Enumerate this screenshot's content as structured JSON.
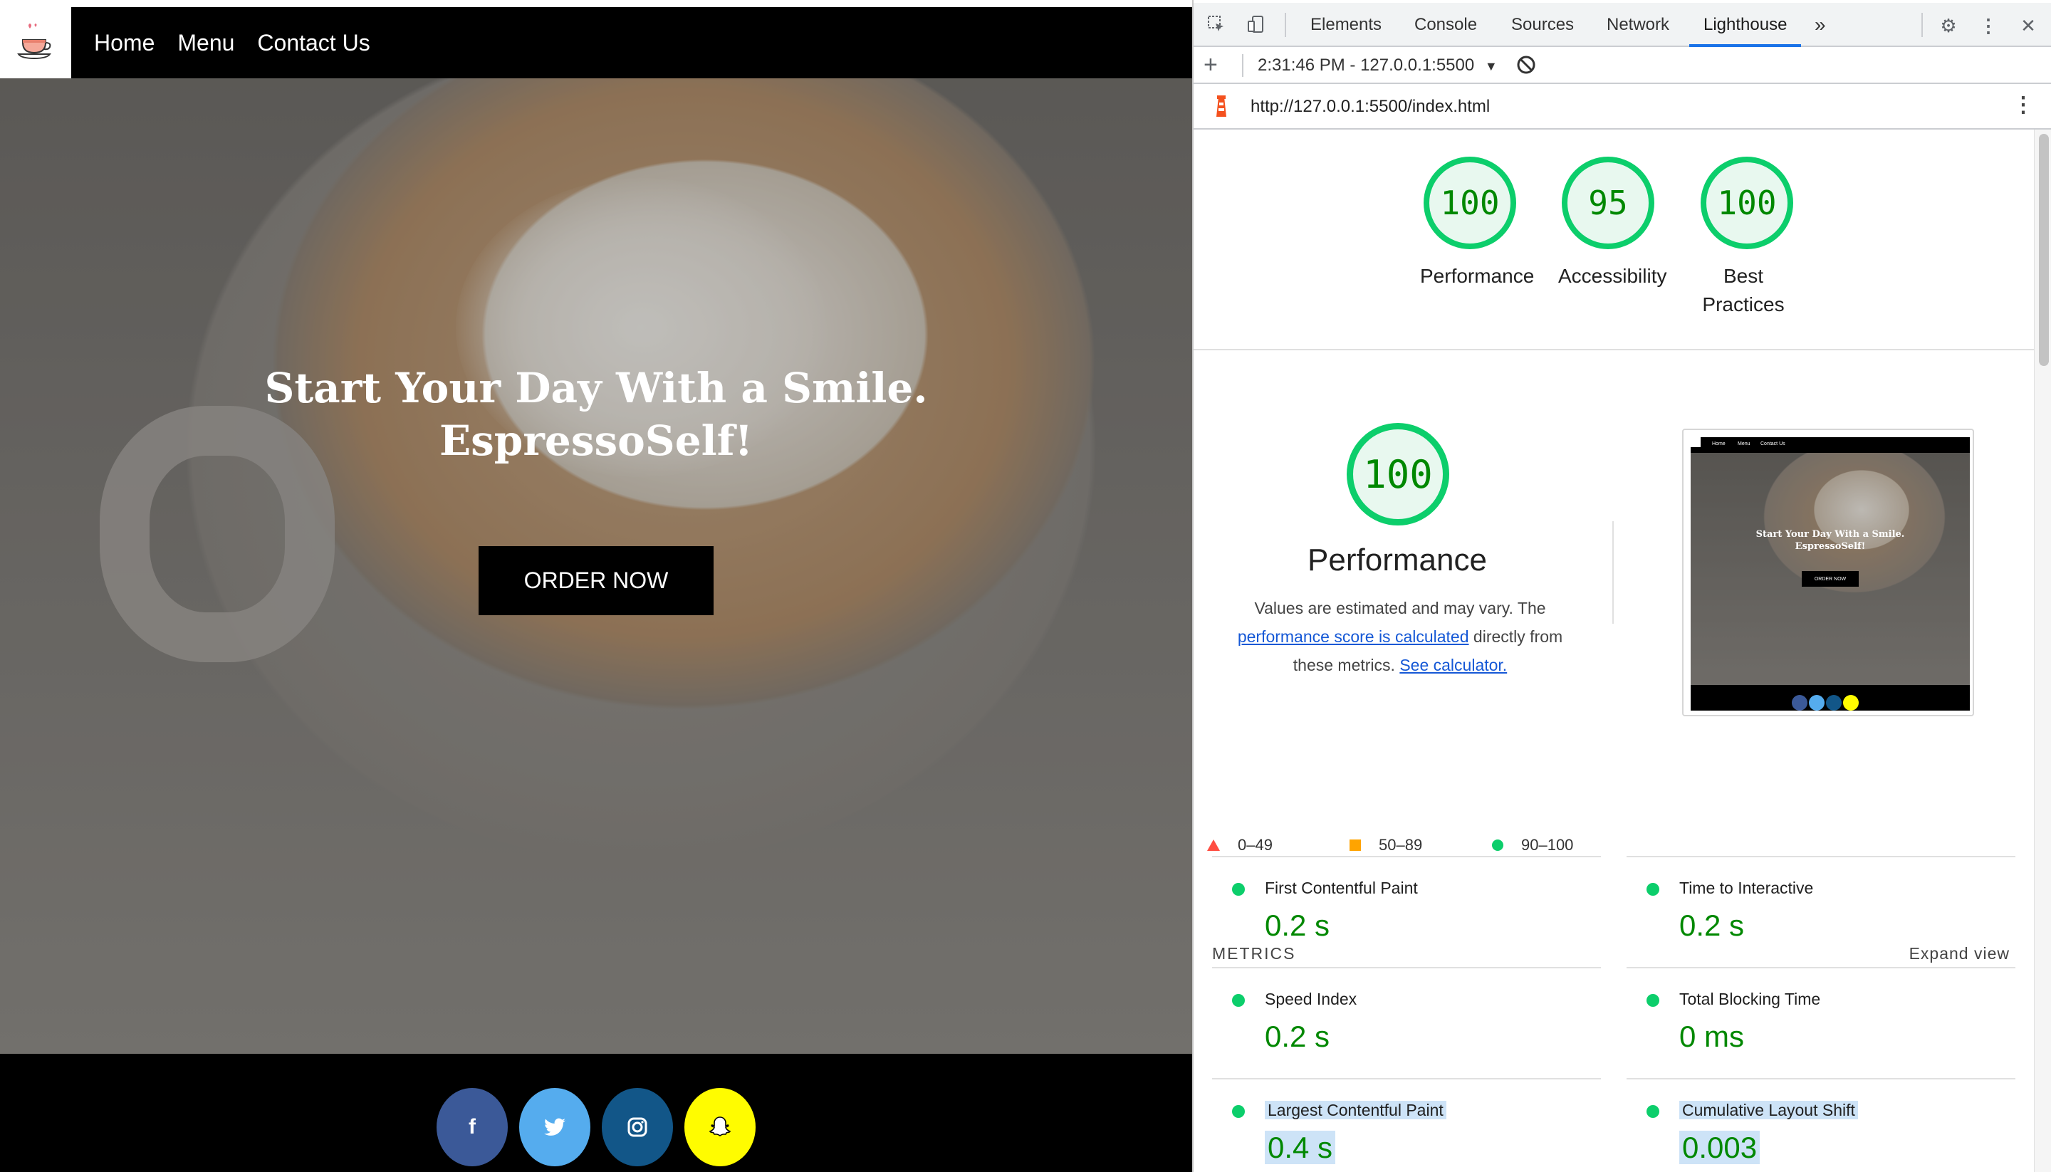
{
  "site": {
    "nav": [
      "Home",
      "Menu",
      "Contact Us"
    ],
    "hero_line1": "Start Your Day With a Smile.",
    "hero_line2": "EspressoSelf!",
    "order_button": "ORDER NOW",
    "social": [
      {
        "name": "facebook",
        "glyph": "f",
        "color": "#3b5998"
      },
      {
        "name": "twitter",
        "glyph": "t",
        "color": "#55acee"
      },
      {
        "name": "instagram",
        "glyph": "◎",
        "color": "#125688"
      },
      {
        "name": "snapchat",
        "glyph": "👻",
        "color": "#fffc00"
      }
    ]
  },
  "devtools": {
    "tabs": [
      "Elements",
      "Console",
      "Sources",
      "Network",
      "Lighthouse"
    ],
    "active_tab": "Lighthouse",
    "more_tabs": "»",
    "report_selector": "2:31:46 PM - 127.0.0.1:5500",
    "url": "http://127.0.0.1:5500/index.html"
  },
  "lighthouse": {
    "gauges": [
      {
        "score": "100",
        "label": "Performance"
      },
      {
        "score": "95",
        "label": "Accessibility"
      },
      {
        "score": "100",
        "label": "Best Practices"
      }
    ],
    "performance": {
      "score": "100",
      "title": "Performance",
      "desc_1": "Values are estimated and may vary. The",
      "desc_link1": "performance score is calculated",
      "desc_2": "directly from",
      "desc_3": "these metrics.",
      "desc_link2": "See calculator."
    },
    "legend": [
      {
        "range": "0–49",
        "color": "#ff4e42"
      },
      {
        "range": "50–89",
        "color": "#ffa400"
      },
      {
        "range": "90–100",
        "color": "#0cce6b"
      }
    ],
    "thumbnail": {
      "nav": [
        "Home",
        "Menu",
        "Contact Us"
      ],
      "line1": "Start Your Day With a Smile.",
      "line2": "EspressoSelf!",
      "button": "ORDER NOW"
    },
    "metrics_title": "METRICS",
    "expand_view": "Expand view",
    "metrics": [
      {
        "name": "First Contentful Paint",
        "value": "0.2 s"
      },
      {
        "name": "Time to Interactive",
        "value": "0.2 s"
      },
      {
        "name": "Speed Index",
        "value": "0.2 s"
      },
      {
        "name": "Total Blocking Time",
        "value": "0 ms"
      },
      {
        "name": "Largest Contentful Paint",
        "value": "0.4 s"
      },
      {
        "name": "Cumulative Layout Shift",
        "value": "0.003"
      }
    ]
  }
}
